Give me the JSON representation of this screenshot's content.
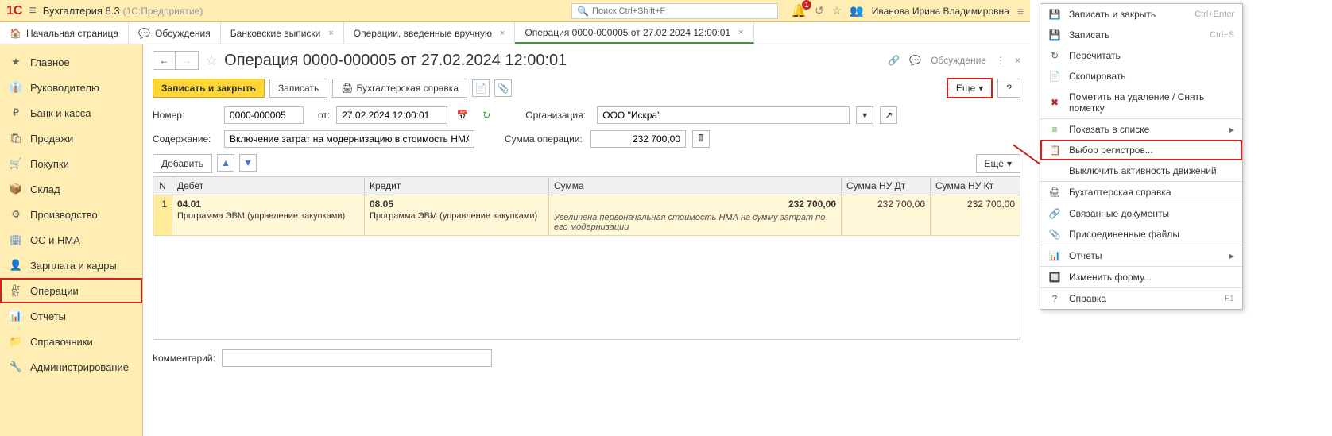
{
  "header": {
    "logo": "1C",
    "app_title": "Бухгалтерия 8.3",
    "app_subtitle": "(1С:Предприятие)",
    "search_placeholder": "Поиск Ctrl+Shift+F",
    "bell_count": "1",
    "user_name": "Иванова Ирина Владимировна"
  },
  "tabs": {
    "home": "Начальная страница",
    "discuss": "Обсуждения",
    "t1": "Банковские выписки",
    "t2": "Операции, введенные вручную",
    "t3": "Операция 0000-000005 от 27.02.2024 12:00:01"
  },
  "sidebar": {
    "main": "Главное",
    "manager": "Руководителю",
    "bank": "Банк и касса",
    "sales": "Продажи",
    "purchases": "Покупки",
    "warehouse": "Склад",
    "production": "Производство",
    "osnma": "ОС и НМА",
    "salary": "Зарплата и кадры",
    "operations": "Операции",
    "reports": "Отчеты",
    "directories": "Справочники",
    "admin": "Администрирование"
  },
  "doc": {
    "title": "Операция 0000-000005 от 27.02.2024 12:00:01",
    "discuss": "Обсуждение",
    "save_close": "Записать и закрыть",
    "save": "Записать",
    "accounting_ref": "Бухгалтерская справка",
    "eshe": "Еще",
    "number_label": "Номер:",
    "number_value": "0000-000005",
    "from_label": "от:",
    "date_value": "27.02.2024 12:00:01",
    "org_label": "Организация:",
    "org_value": "ООО \"Искра\"",
    "content_label": "Содержание:",
    "content_value": "Включение затрат на модернизацию в стоимость НМА",
    "sum_label": "Сумма операции:",
    "sum_value": "232 700,00",
    "add": "Добавить",
    "comment_label": "Комментарий:"
  },
  "grid": {
    "h_n": "N",
    "h_debet": "Дебет",
    "h_kredit": "Кредит",
    "h_sum": "Сумма",
    "h_nudt": "Сумма НУ Дт",
    "h_nukt": "Сумма НУ Кт",
    "row1": {
      "n": "1",
      "debet_acc": "04.01",
      "debet_sub": "Программа ЭВМ (управление закупками)",
      "kredit_acc": "08.05",
      "kredit_sub": "Программа ЭВМ (управление закупками)",
      "sum": "232 700,00",
      "desc": "Увеличена первоначальная стоимость НМА на сумму затрат по его модернизации",
      "nudt": "232 700,00",
      "nukt": "232 700,00"
    }
  },
  "ctx": {
    "save_close": "Записать и закрыть",
    "save_close_sc": "Ctrl+Enter",
    "save": "Записать",
    "save_sc": "Ctrl+S",
    "reread": "Перечитать",
    "copy": "Скопировать",
    "mark_delete": "Пометить на удаление / Снять пометку",
    "show_list": "Показать в списке",
    "choose_reg": "Выбор регистров...",
    "disable_movements": "Выключить активность движений",
    "accounting_ref": "Бухгалтерская справка",
    "related_docs": "Связанные документы",
    "attached_files": "Присоединенные файлы",
    "reports": "Отчеты",
    "change_form": "Изменить форму...",
    "help": "Справка",
    "help_sc": "F1"
  }
}
